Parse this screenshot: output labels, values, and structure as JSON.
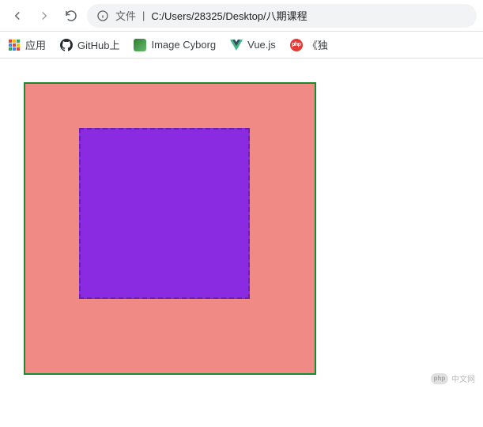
{
  "toolbar": {
    "url_prefix": "文件",
    "url_separator": " | ",
    "url_path": "C:/Users/28325/Desktop/八期课程"
  },
  "bookmarks": {
    "apps_label": "应用",
    "github_label": "GitHub上",
    "cyborg_label": "Image Cyborg",
    "vue_label": "Vue.js",
    "php_icon_text": "php",
    "last_label": "《独"
  },
  "watermark": {
    "badge_text": "php",
    "text": "中文网"
  },
  "apps_colors": [
    "#ea4335",
    "#fbbc05",
    "#34a853",
    "#4285f4",
    "#ea4335",
    "#fbbc05",
    "#34a853",
    "#4285f4",
    "#ea4335"
  ]
}
